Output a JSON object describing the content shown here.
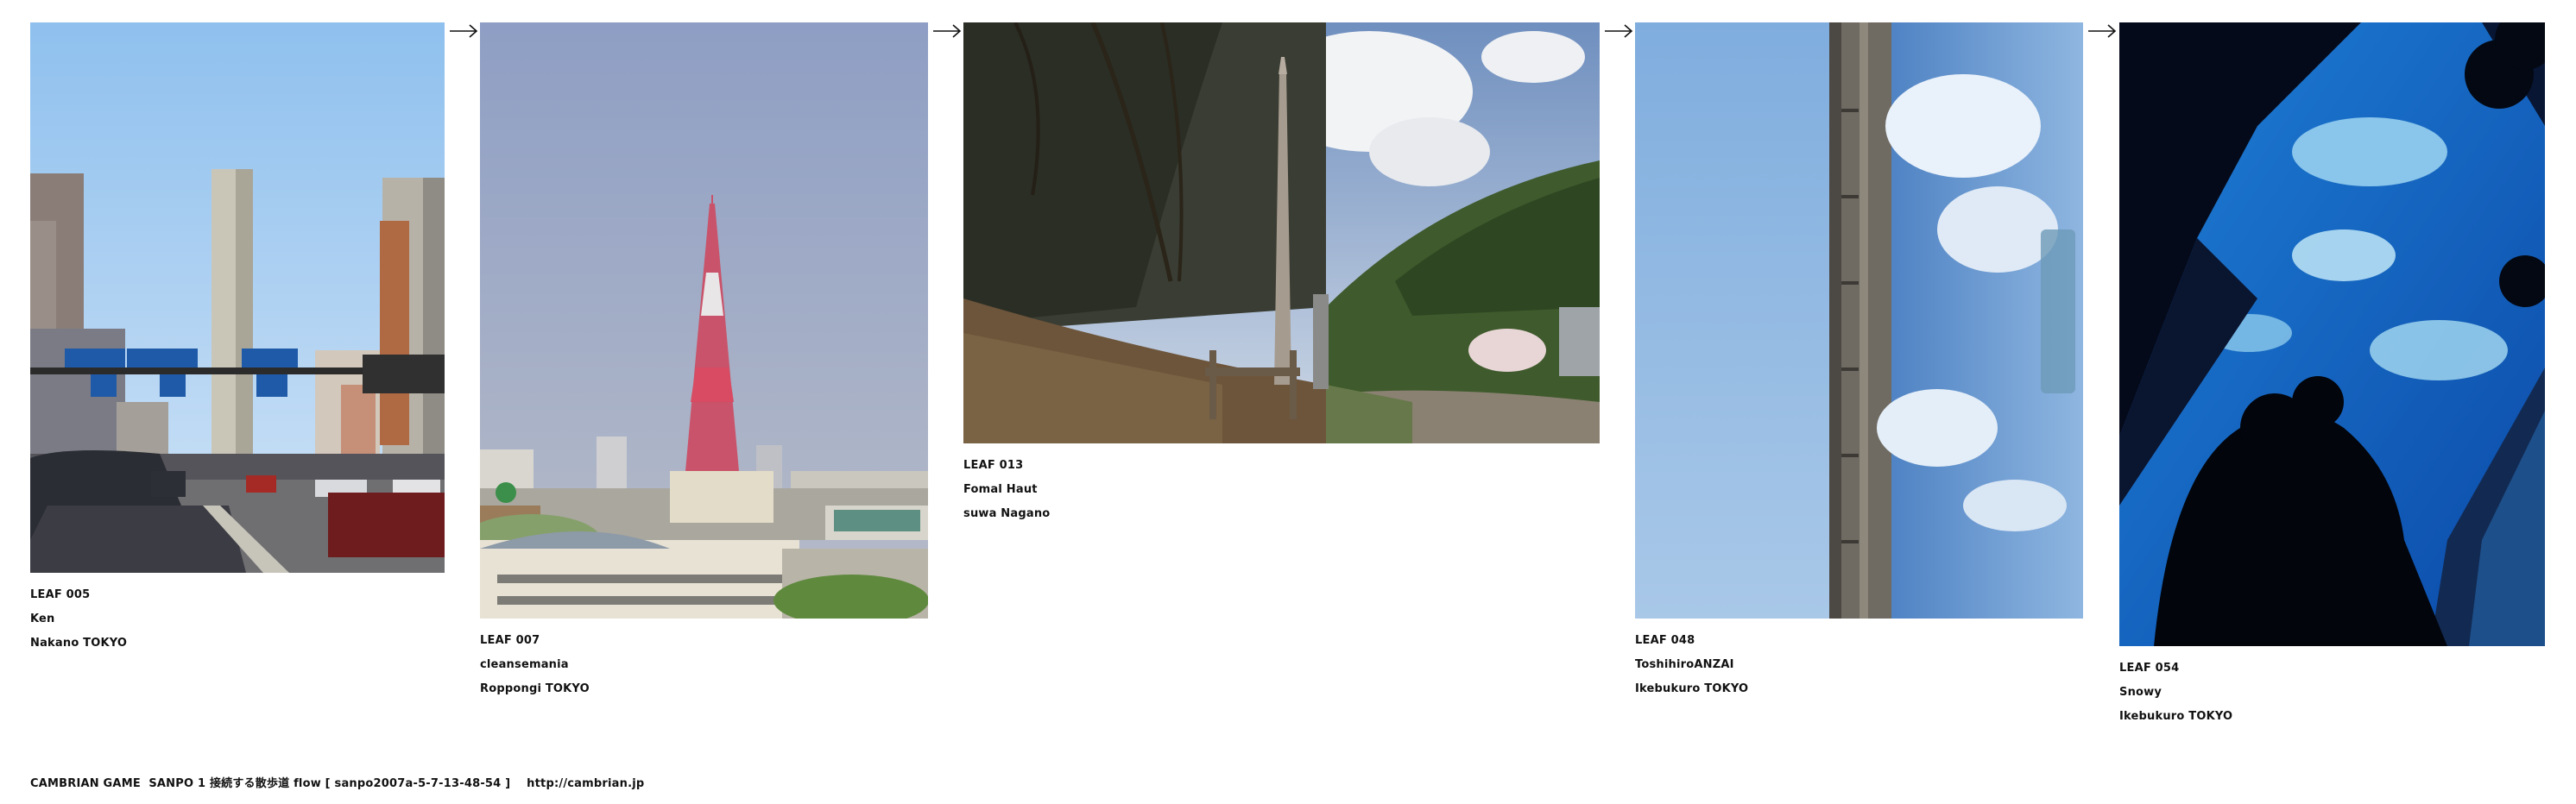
{
  "arrow_glyph": "→",
  "leaves": [
    {
      "leaf": "LEAF 005",
      "author": "Ken",
      "place": "Nakano TOKYO"
    },
    {
      "leaf": "LEAF 007",
      "author": "cleansemania",
      "place": "Roppongi TOKYO"
    },
    {
      "leaf": "LEAF 013",
      "author": "Fomal Haut",
      "place": "suwa Nagano"
    },
    {
      "leaf": "LEAF 048",
      "author": "ToshihiroANZAI",
      "place": "Ikebukuro TOKYO"
    },
    {
      "leaf": "LEAF 054",
      "author": "Snowy",
      "place": "Ikebukuro TOKYO"
    }
  ],
  "footer": {
    "text": "CAMBRIAN GAME  SANPO 1 接続する散歩道 flow [ sanpo2007a-5-7-13-48-54 ]    http://cambrian.jp"
  }
}
